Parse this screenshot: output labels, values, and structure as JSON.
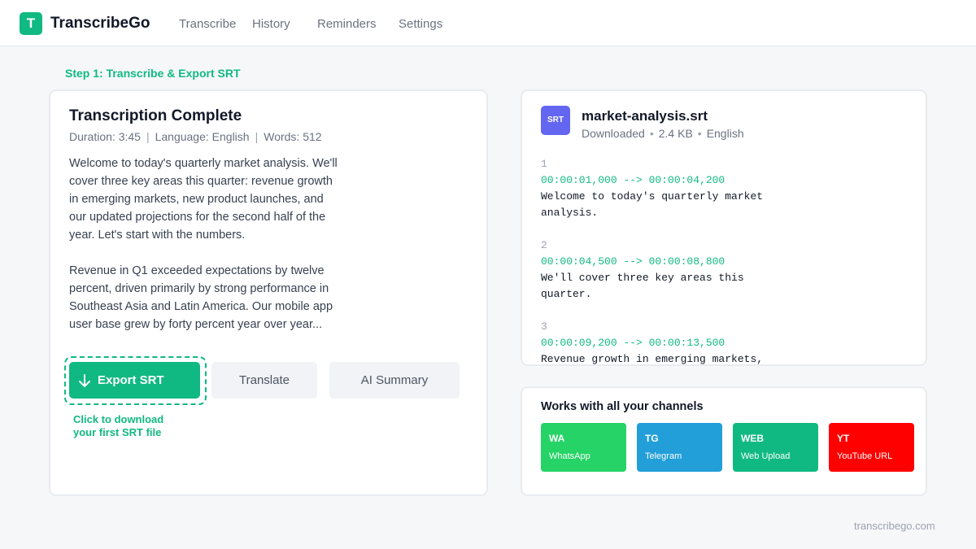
{
  "header": {
    "logo_letter": "T",
    "brand": "TranscribeGo",
    "nav": [
      {
        "label": "Transcribe"
      },
      {
        "label": "History"
      },
      {
        "label": "Reminders"
      },
      {
        "label": "Settings"
      }
    ]
  },
  "step_label": "Step 1: Transcribe & Export SRT",
  "transcription": {
    "title": "Transcription Complete",
    "meta": {
      "duration": "Duration: 3:45",
      "language": "Language: English",
      "words": "Words: 512"
    },
    "paragraphs": [
      "Welcome to today's quarterly market analysis. We'll cover three key areas this quarter: revenue growth in emerging markets, new product launches, and our updated projections for the second half of the year. Let's start with the numbers.",
      "Revenue in Q1 exceeded expectations by twelve percent, driven primarily by strong performance in Southeast Asia and Latin America. Our mobile app user base grew by forty percent year over year..."
    ],
    "buttons": {
      "export": "Export SRT",
      "translate": "Translate",
      "summary": "AI Summary"
    },
    "hint_line1": "Click to download",
    "hint_line2": "your first SRT file"
  },
  "srt_file": {
    "badge": "SRT",
    "filename": "market-analysis.srt",
    "status": "Downloaded",
    "size": "2.4 KB",
    "language": "English",
    "entries": [
      {
        "index": "1",
        "time": "00:00:01,000 --> 00:00:04,200",
        "line1": "Welcome to today's quarterly market",
        "line2": "analysis."
      },
      {
        "index": "2",
        "time": "00:00:04,500 --> 00:00:08,800",
        "line1": "We'll cover three key areas this",
        "line2": "quarter."
      },
      {
        "index": "3",
        "time": "00:00:09,200 --> 00:00:13,500",
        "line1": "Revenue growth in emerging markets,",
        "line2": ""
      }
    ]
  },
  "channels": {
    "title": "Works with all your channels",
    "items": [
      {
        "code": "WA",
        "name": "WhatsApp",
        "color": "#25d366"
      },
      {
        "code": "TG",
        "name": "Telegram",
        "color": "#229ed9"
      },
      {
        "code": "WEB",
        "name": "Web Upload",
        "color": "#10b981"
      },
      {
        "code": "YT",
        "name": "YouTube URL",
        "color": "#ff0000"
      }
    ]
  },
  "footer": "transcribego.com",
  "colors": {
    "accent": "#10b981",
    "srt_badge": "#6366f1"
  }
}
